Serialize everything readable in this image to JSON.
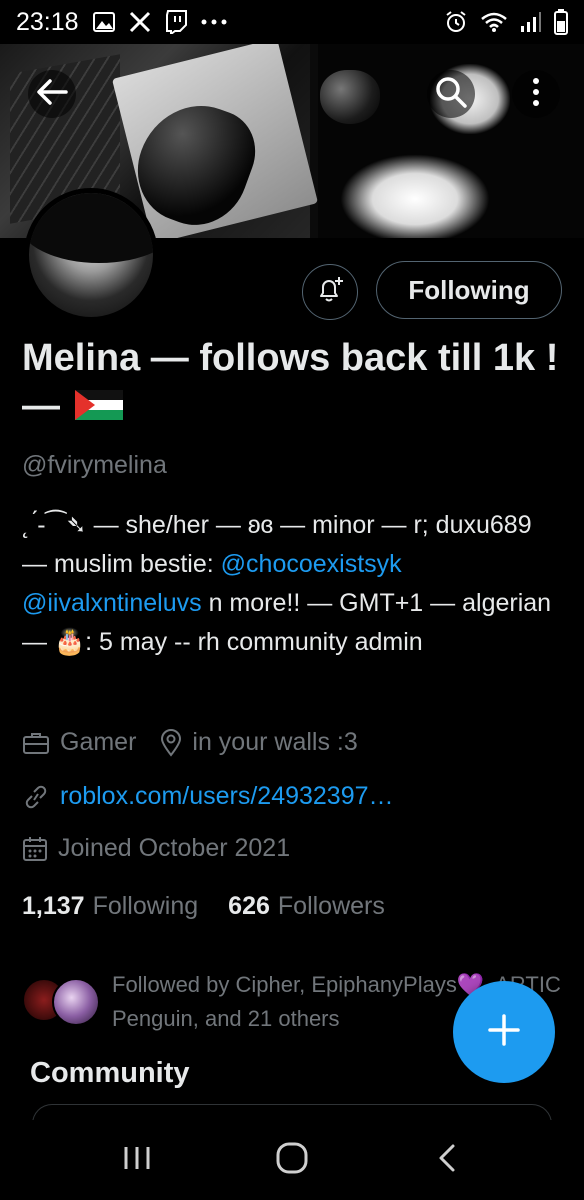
{
  "status_bar": {
    "time": "23:18",
    "left_icons": [
      "image-icon",
      "x-logo-icon",
      "twitch-icon",
      "more-dots-icon"
    ],
    "right_icons": [
      "alarm-icon",
      "wifi-icon",
      "signal-icon",
      "battery-icon"
    ]
  },
  "header": {
    "back_icon": "arrow-left-icon",
    "search_icon": "search-icon",
    "more_icon": "more-vertical-icon"
  },
  "actions": {
    "notify_icon": "bell-plus-icon",
    "following_label": "Following"
  },
  "profile": {
    "name": "Melina — follows back till 1k ! —",
    "name_emoji": "palestine-flag",
    "handle": "@fvirymelina",
    "bio_part1": "˛ ́-⁀➴ — she/her — ʚɞ —  minor — r; duxu689 — muslim bestie:",
    "bio_mention1": "@chocoexistsyk",
    "bio_mention2": "@iivalxntineluvs",
    "bio_part2": "n more!! — GMT+1 — algerian —",
    "bio_emoji": "🎂",
    "bio_part3": ": 5 may -- rh community admin",
    "category": "Gamer",
    "location": "in your walls :3",
    "website": "roblox.com/users/24932397…",
    "joined": "Joined October 2021"
  },
  "stats": {
    "following_count": "1,137",
    "following_label": "Following",
    "followers_count": "626",
    "followers_label": "Followers"
  },
  "followed_by": {
    "text": "Followed by Cipher, EpiphanyPlays💜, ARTIC Penguin, and 21 others"
  },
  "sections": {
    "community_title": "Community"
  },
  "fab": {
    "icon": "plus-icon",
    "color": "#1d9bf0"
  },
  "nav": {
    "icons": [
      "recents-icon",
      "home-icon",
      "back-icon"
    ]
  },
  "colors": {
    "background": "#000000",
    "text_primary": "#e7e9ea",
    "text_secondary": "#71767b",
    "link": "#1d9bf0",
    "border": "#536471"
  }
}
